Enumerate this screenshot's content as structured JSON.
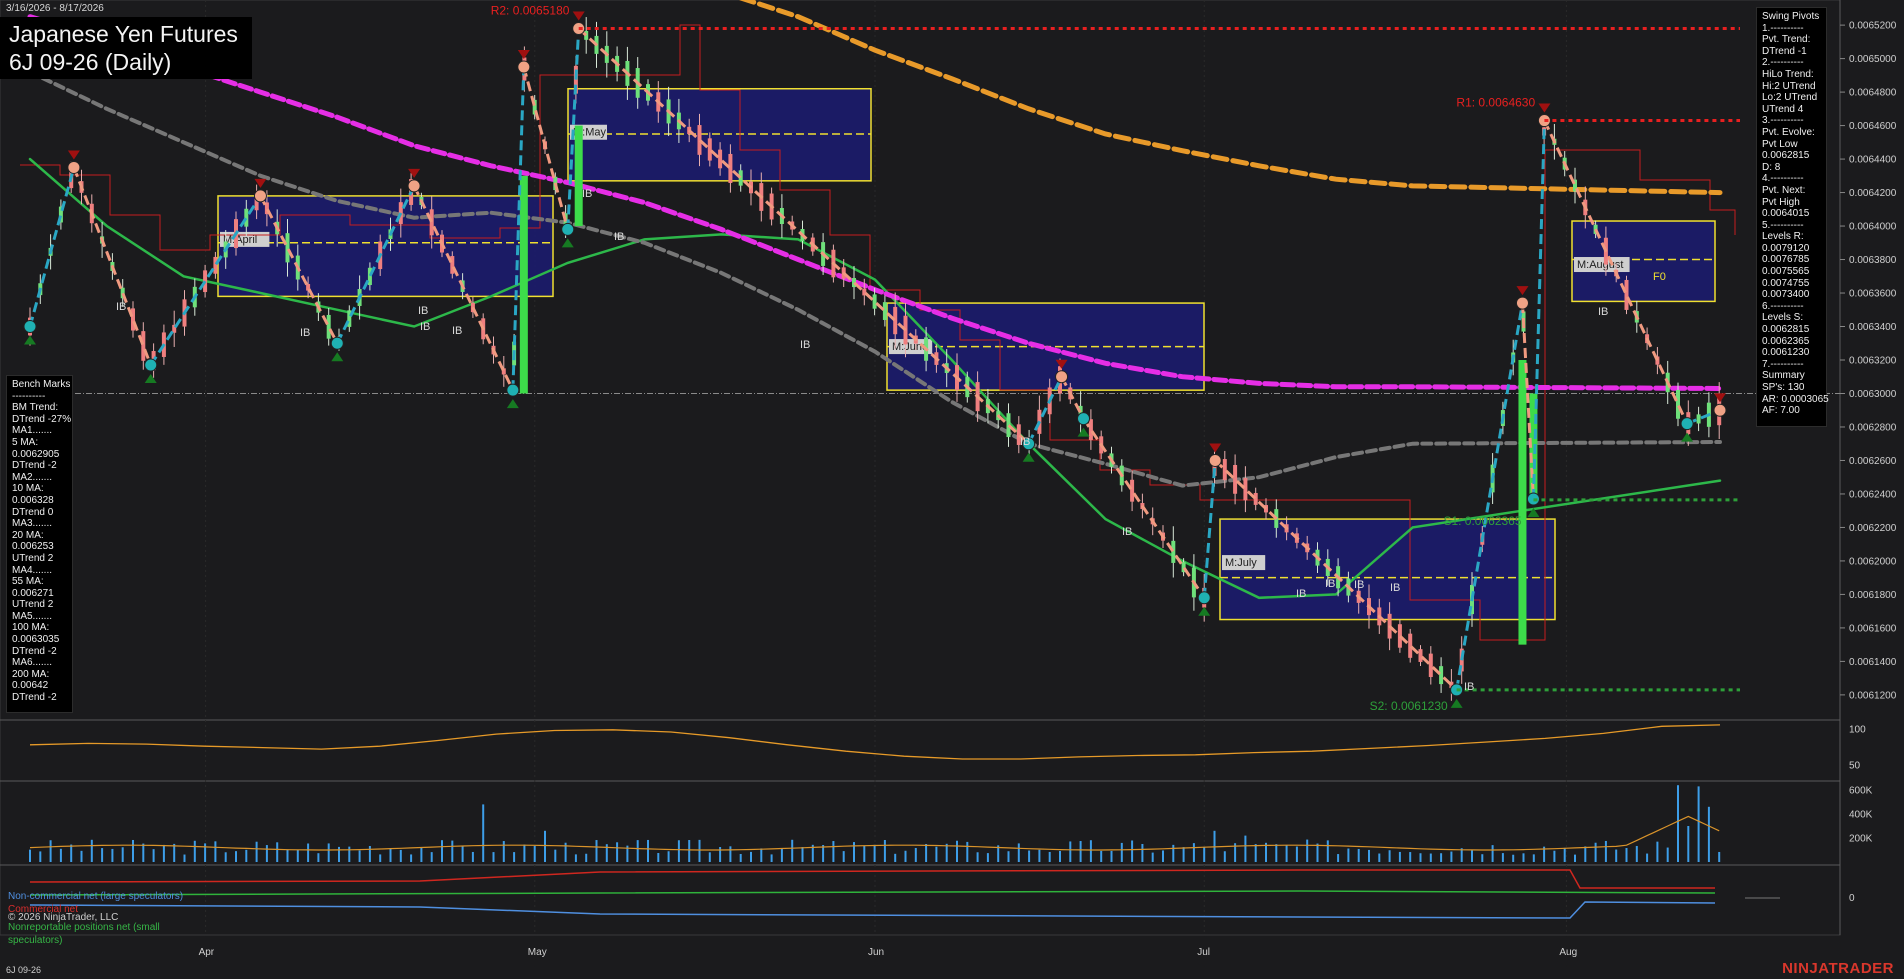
{
  "header": {
    "date_range": "3/16/2026 - 8/17/2026",
    "title_line1": "Japanese Yen Futures",
    "title_line2": "6J 09-26 (Daily)"
  },
  "colors": {
    "background": "#1b1b1d",
    "ma5": "#2ec7c9",
    "ma20": "#2db84a",
    "ma55": "#777777",
    "ma100": "#e62ee6",
    "ma200": "#e89a2a",
    "resistance": "#e8262a",
    "support": "#1f9c2e",
    "month_box": "#f0e030"
  },
  "chart_data": {
    "type": "line",
    "x_labels": [
      "Apr",
      "May",
      "Jun",
      "Jul",
      "Aug"
    ],
    "ylim": [
      0.006105,
      0.006535
    ],
    "y_ticks": [
      "0.0065200",
      "0.0065000",
      "0.0064800",
      "0.0064600",
      "0.0064400",
      "0.0064200",
      "0.0064000",
      "0.0063800",
      "0.0063600",
      "0.0063400",
      "0.0063200",
      "0.0063000",
      "0.0062800",
      "0.0062600",
      "0.0062400",
      "0.0062200",
      "0.0062000",
      "0.0061800",
      "0.0061600",
      "0.0061400",
      "0.0061200"
    ],
    "price_points": [
      {
        "x": "Mar 16",
        "y": 0.00634
      },
      {
        "x": "Mar 20",
        "y": 0.006435
      },
      {
        "x": "Mar 27",
        "y": 0.006317
      },
      {
        "x": "Apr 06",
        "y": 0.006418
      },
      {
        "x": "Apr 13",
        "y": 0.00633
      },
      {
        "x": "Apr 20",
        "y": 0.006424
      },
      {
        "x": "Apr 29",
        "y": 0.006302
      },
      {
        "x": "Apr 30",
        "y": 0.006495
      },
      {
        "x": "May 04",
        "y": 0.006398
      },
      {
        "x": "May 05",
        "y": 0.006518
      },
      {
        "x": "Jun 15",
        "y": 0.00627
      },
      {
        "x": "Jun 18",
        "y": 0.00631
      },
      {
        "x": "Jun 20",
        "y": 0.006285
      },
      {
        "x": "Jul 01",
        "y": 0.006178
      },
      {
        "x": "Jul 02",
        "y": 0.00626
      },
      {
        "x": "Jul 24",
        "y": 0.006123
      },
      {
        "x": "Jul 30",
        "y": 0.006354
      },
      {
        "x": "Jul 31",
        "y": 0.006237
      },
      {
        "x": "Aug 01",
        "y": 0.006463
      },
      {
        "x": "Aug 14",
        "y": 0.006282
      },
      {
        "x": "Aug 17",
        "y": 0.00629
      }
    ],
    "moving_averages": [
      {
        "name": "MA20",
        "values": [
          0.00644,
          0.0064,
          0.00637,
          0.00636,
          0.00635,
          0.00634,
          0.006358,
          0.006378,
          0.006392,
          0.006395,
          0.006392,
          0.006368,
          0.00632,
          0.00627,
          0.006225,
          0.0062,
          0.006178,
          0.00618,
          0.00622,
          0.006248
        ]
      },
      {
        "name": "MA55",
        "values": [
          0.006492,
          0.00647,
          0.00645,
          0.00643,
          0.006415,
          0.006405,
          0.006408,
          0.006402,
          0.00639,
          0.006372,
          0.00635,
          0.006325,
          0.006295,
          0.00627,
          0.006258,
          0.006245,
          0.00625,
          0.006262,
          0.00627,
          0.006271
        ]
      },
      {
        "name": "MA100",
        "values": [
          0.006525,
          0.006512,
          0.006495,
          0.00648,
          0.006465,
          0.006448,
          0.006436,
          0.006426,
          0.006414,
          0.006398,
          0.00638,
          0.006362,
          0.006345,
          0.00633,
          0.006318,
          0.00631,
          0.006306,
          0.006304,
          0.006304,
          0.006303
        ]
      },
      {
        "name": "MA200",
        "values": [
          null,
          null,
          null,
          null,
          null,
          null,
          null,
          null,
          null,
          0.00654,
          0.006525,
          0.006505,
          0.006488,
          0.00647,
          0.006455,
          0.006445,
          0.006436,
          0.006428,
          0.006424,
          0.00642
        ]
      }
    ],
    "ma_x": [
      "Mar 16",
      "Mar 23",
      "Mar 30",
      "Apr 06",
      "Apr 13",
      "Apr 20",
      "Apr 27",
      "May 04",
      "May 11",
      "May 18",
      "May 25",
      "Jun 01",
      "Jun 08",
      "Jun 15",
      "Jun 22",
      "Jun 29",
      "Jul 06",
      "Jul 13",
      "Jul 20",
      "Aug 17"
    ],
    "levels": [
      {
        "label": "R2: 0.0065180",
        "value": 0.006518,
        "kind": "resistance"
      },
      {
        "label": "R1: 0.0064630",
        "value": 0.006463,
        "kind": "resistance"
      },
      {
        "label": "S1: 0.0062365",
        "value": 0.0062365,
        "kind": "support"
      },
      {
        "label": "S2: 0.0061230",
        "value": 0.006123,
        "kind": "support"
      }
    ],
    "month_boxes": [
      {
        "label": "M:April",
        "high": 0.006418,
        "low": 0.006358,
        "mid": 0.00639
      },
      {
        "label": "M:May",
        "high": 0.006482,
        "low": 0.006427,
        "mid": 0.006455
      },
      {
        "label": "M:June",
        "high": 0.006354,
        "low": 0.006302,
        "mid": 0.006328
      },
      {
        "label": "M:July",
        "high": 0.006225,
        "low": 0.006165,
        "mid": 0.00619
      },
      {
        "label": "M:August",
        "high": 0.006403,
        "low": 0.006355,
        "mid": 0.00638
      }
    ],
    "ib_marks": [
      "IB",
      "IB",
      "IB",
      "IB",
      "IB",
      "IB",
      "IB",
      "IB",
      "IB",
      "IB",
      "IB",
      "IB",
      "IB",
      "IB",
      "IB",
      "IB"
    ],
    "f0_label": "F0",
    "oscillator_ticks": [
      "100",
      "50"
    ],
    "volume_ticks": [
      "600K",
      "400K",
      "200K"
    ],
    "cot_ticks": [
      "0"
    ]
  },
  "bench_marks": {
    "lines": [
      "Bench Marks",
      "----------",
      "BM Trend:",
      "DTrend -27%",
      "MA1.......",
      "5 MA:",
      "0.0062905",
      "DTrend -2",
      "MA2.......",
      "10 MA:",
      "0.006328",
      "DTrend 0",
      "MA3.......",
      "20 MA:",
      "0.006253",
      "UTrend 2",
      "MA4.......",
      "55 MA:",
      "0.006271",
      "UTrend 2",
      "MA5.......",
      "100 MA:",
      "0.0063035",
      "DTrend -2",
      "MA6.......",
      "200 MA:",
      "0.00642",
      "DTrend -2"
    ]
  },
  "swing_pivots": {
    "lines": [
      "Swing Pivots",
      "1.----------",
      "Pvt. Trend:",
      "DTrend -1",
      "2.----------",
      "HiLo Trend:",
      "Hi:2 UTrend",
      "Lo:2 UTrend",
      "UTrend 4",
      "3.----------",
      "Pvt. Evolve:",
      "Pvt Low",
      "0.0062815",
      "D: 8",
      "4.----------",
      "Pvt. Next:",
      "Pvt High",
      "0.0064015",
      "5.----------",
      "Levels R:",
      "0.0079120",
      "0.0076785",
      "0.0075565",
      "0.0074755",
      "0.0073400",
      "6.----------",
      "Levels S:",
      "0.0062815",
      "0.0062365",
      "0.0061230",
      "7.----------",
      "Summary",
      "SP's: 130",
      "AR: 0.0003065",
      "AF: 7.00"
    ]
  },
  "cot_legend": {
    "noncommercial": "Non-commercial net (large speculators)",
    "commercial": "Commercial net",
    "copyright": "© 2026 NinjaTrader, LLC",
    "nonreportable": "Nonreportable positions net (small speculators)"
  },
  "footer": {
    "symbol": "6J 09-26",
    "brand": "NINJATRADER"
  }
}
